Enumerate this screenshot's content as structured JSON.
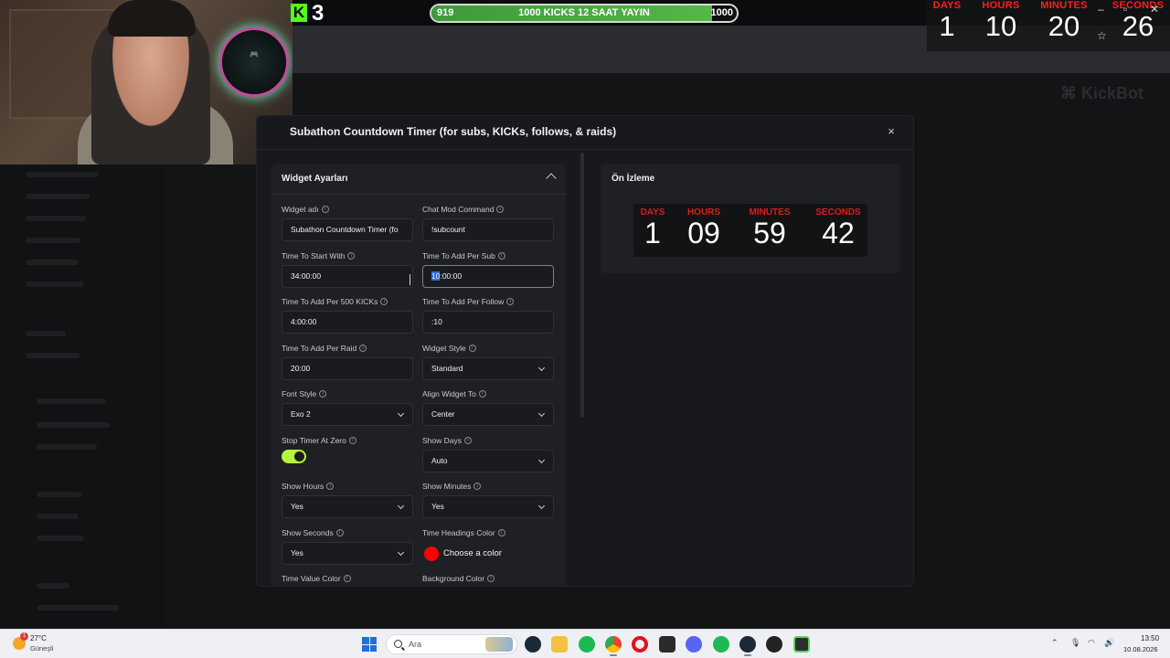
{
  "stream_overlay": {
    "kick_logo": "K",
    "kick_count": "3",
    "goal": {
      "start": "919",
      "title": "1000 KICKS 12 SAAT YAYIN",
      "end": "1000",
      "progress": 0.92
    },
    "timer": [
      {
        "label": "DAYS",
        "value": "1"
      },
      {
        "label": "HOURS",
        "value": "10"
      },
      {
        "label": "MINUTES",
        "value": "20"
      },
      {
        "label": "SECONDS",
        "value": "26"
      }
    ],
    "star": "☆"
  },
  "background_app": {
    "logo": "⌘ KickBot"
  },
  "modal": {
    "title": "Subathon Countdown Timer (for subs, KICKs, follows, & raids)",
    "close": "×",
    "settings": {
      "header": "Widget Ayarları",
      "fields": {
        "widget_name": {
          "label": "Widget adı",
          "value": "Subathon Countdown Timer (fo"
        },
        "chat_mod_command": {
          "label": "Chat Mod Command",
          "value": "!subcount"
        },
        "time_to_start": {
          "label": "Time To Start With",
          "value": "34:00:00"
        },
        "time_per_sub": {
          "label": "Time To Add Per Sub",
          "value_selected": "10",
          "value_rest": ":00:00"
        },
        "time_per_500_kicks": {
          "label": "Time To Add Per 500 KICKs",
          "value": "4:00:00"
        },
        "time_per_follow": {
          "label": "Time To Add Per Follow",
          "value": ":10"
        },
        "time_per_raid": {
          "label": "Time To Add Per Raid",
          "value": "20:00"
        },
        "widget_style": {
          "label": "Widget Style",
          "value": "Standard"
        },
        "font_style": {
          "label": "Font Style",
          "value": "Exo 2"
        },
        "align_widget": {
          "label": "Align Widget To",
          "value": "Center"
        },
        "stop_timer_at_zero": {
          "label": "Stop Timer At Zero",
          "enabled": true
        },
        "show_days": {
          "label": "Show Days",
          "value": "Auto"
        },
        "show_hours": {
          "label": "Show Hours",
          "value": "Yes"
        },
        "show_minutes": {
          "label": "Show Minutes",
          "value": "Yes"
        },
        "show_seconds": {
          "label": "Show Seconds",
          "value": "Yes"
        },
        "time_headings_color": {
          "label": "Time Headings Color",
          "button": "Choose a color",
          "color": "#ff0000"
        },
        "time_value_color": {
          "label": "Time Value Color"
        },
        "background_color": {
          "label": "Background Color"
        }
      }
    },
    "preview": {
      "title": "Ön İzleme",
      "timer": [
        {
          "label": "DAYS",
          "value": "1"
        },
        {
          "label": "HOURS",
          "value": "09"
        },
        {
          "label": "MINUTES",
          "value": "59"
        },
        {
          "label": "SECONDS",
          "value": "42"
        }
      ]
    }
  },
  "taskbar": {
    "weather": {
      "temp": "27°C",
      "desc": "Güneşli",
      "badge": "1"
    },
    "search_placeholder": "Ara",
    "clock": {
      "time": "13:50",
      "date": "10.08.2026"
    },
    "apps": [
      "steam",
      "file-explorer",
      "spotify",
      "chrome",
      "opera",
      "epic-games",
      "discord",
      "spotify",
      "steam",
      "xbox",
      "terminal"
    ]
  },
  "colors": {
    "accent_red": "#ff1e1e",
    "toggle_green": "#b5f53c",
    "goal_green": "#56b648"
  }
}
